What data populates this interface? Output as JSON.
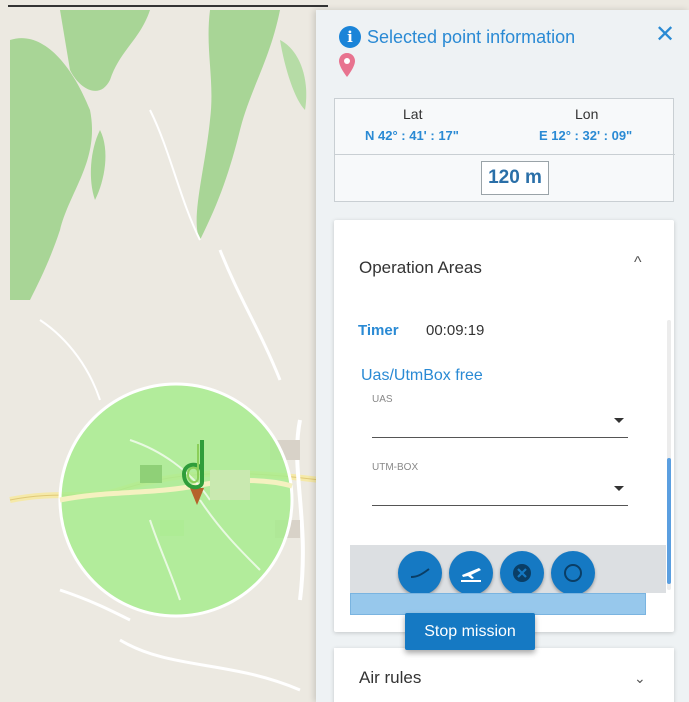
{
  "panel": {
    "title": "Selected point information",
    "coords": {
      "lat_label": "Lat",
      "lon_label": "Lon",
      "lat_value": "N 42° : 41' : 17\"",
      "lon_value": "E 12° : 32' : 09\"",
      "altitude": "120 m"
    }
  },
  "operation_areas": {
    "title": "Operation Areas",
    "timer_label": "Timer",
    "timer_value": "00:09:19",
    "subsection_title": "Uas/UtmBox free",
    "uas_label": "UAS",
    "utm_box_label": "UTM-BOX"
  },
  "stop_mission_label": "Stop mission",
  "air_rules": {
    "title": "Air rules"
  },
  "colors": {
    "accent": "#2a8ad4",
    "button": "#1579c3",
    "zone_fill": "#a8ec8e"
  },
  "icons": [
    "info-icon",
    "close-icon",
    "location-pin-icon",
    "chevron-up-icon",
    "chevron-down-icon",
    "drone-marker-icon",
    "flight-icon",
    "takeoff-icon",
    "cancel-icon",
    "circle-icon"
  ]
}
